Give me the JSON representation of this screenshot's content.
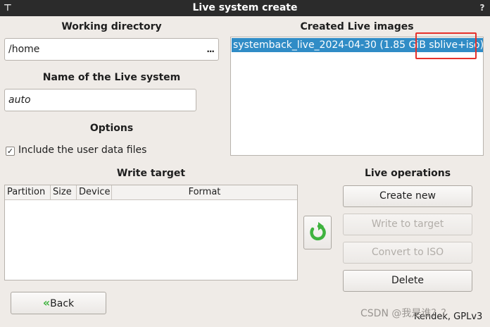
{
  "window": {
    "title": "Live system create",
    "menu_glyph": "⊤",
    "close_glyph": "?"
  },
  "working_directory": {
    "heading": "Working directory",
    "value": "/home",
    "browse_label": "..."
  },
  "live_name": {
    "heading": "Name of the Live system",
    "value": "auto"
  },
  "options": {
    "heading": "Options",
    "include_user_data": {
      "label": "Include the user data files",
      "checked": true,
      "mark": "✓"
    }
  },
  "created_images": {
    "heading": "Created Live images",
    "items": [
      {
        "label": "systemback_live_2024-04-30 (1.85 GiB sblive+iso)",
        "selected": true
      }
    ]
  },
  "write_target": {
    "heading": "Write target",
    "columns": [
      "Partition",
      "Size",
      "Device",
      "Format"
    ],
    "rows": []
  },
  "refresh_icon": "refresh-icon",
  "live_operations": {
    "heading": "Live operations",
    "create_new": "Create new",
    "write_to_target": "Write to target",
    "convert_to_iso": "Convert to ISO",
    "delete": "Delete"
  },
  "back_button": {
    "icon": "«",
    "label": "Back"
  },
  "footer": {
    "license": "Kendek, GPLv3",
    "watermark": "CSDN @我是谁？？"
  },
  "colors": {
    "window_bg": "#efebe7",
    "titlebar_bg": "#2b2b2b",
    "selection": "#308cc6",
    "highlight_box": "#e5312b",
    "refresh_green": "#3fb33f",
    "back_green": "#3fb33f"
  }
}
